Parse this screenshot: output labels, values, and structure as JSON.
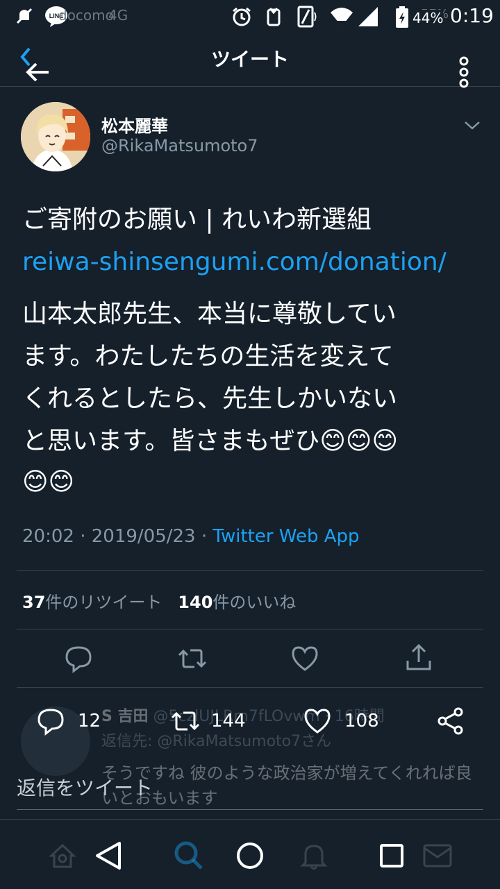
{
  "status_bar": {
    "carrier": "docomo",
    "network": "4G",
    "line_badge": "LINE",
    "battery_percent": "44%",
    "time": "0:19",
    "faded_text": "57%"
  },
  "header": {
    "title": "ツイート"
  },
  "tweet": {
    "display_name": "松本麗華",
    "handle": "@RikaMatsumoto7",
    "headline": "ご寄附のお願い | れいわ新選組",
    "link": "reiwa-shinsengumi.com/donation/",
    "body_line1": "山本太郎先生、本当に尊敬してい",
    "body_line2": "ます。わたしたちの生活を変えて",
    "body_line3": "くれるとしたら、先生しかいない",
    "body_line4": "と思います。皆さまもぜひ😊😊😊",
    "body_line5": "😊😊",
    "time": "20:02",
    "date": "2019/05/23",
    "source": "Twitter Web App",
    "sep": "·",
    "retweet_count": "37",
    "retweet_label": "件のリツイート",
    "like_count": "140",
    "like_label": "件のいいね"
  },
  "reply_preview": {
    "name": "S 吉田",
    "handle_time": "@5czlUJLRm7fLOvwm · 16時間",
    "reply_to": "返信先: @RikaMatsumoto7さん",
    "text": "そうですね 彼のような政治家が増えてくれれば良いとおもいます"
  },
  "overlay": {
    "reply_count": "12",
    "retweet_count": "144",
    "like_count": "108",
    "reply_placeholder": "返信をツイート"
  },
  "colors": {
    "background": "#15202b",
    "accent": "#1da1f2",
    "secondary_text": "#8899a6",
    "divider": "#38444d"
  }
}
